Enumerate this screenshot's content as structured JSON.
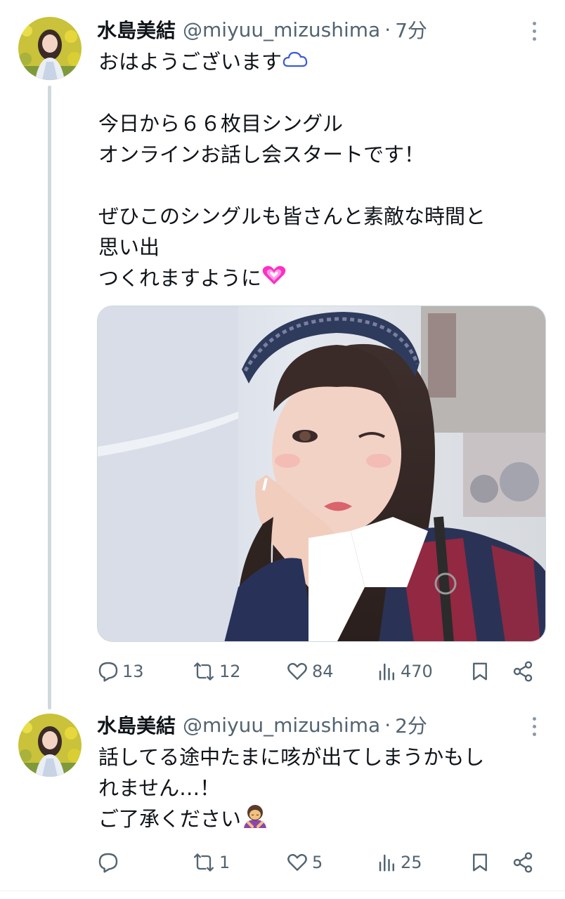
{
  "tweets": [
    {
      "display_name": "水島美結",
      "handle": "@miyuu_mizushima",
      "separator": "·",
      "timestamp": "7分",
      "text_lines": [
        "おはようございます",
        "",
        "今日から６６枚目シングル",
        "オンラインお話し会スタートです！",
        "",
        "ぜひこのシングルも皆さんと素敵な時間と",
        "思い出",
        "つくれますように"
      ],
      "emojis": [
        "cloud-icon",
        "heart-icon"
      ],
      "image_description_icon": "photo",
      "stats": {
        "replies": "13",
        "retweets": "12",
        "likes": "84",
        "views": "470"
      }
    },
    {
      "display_name": "水島美結",
      "handle": "@miyuu_mizushima",
      "separator": "·",
      "timestamp": "2分",
      "text_lines": [
        "話してる途中たまに咳が出てしまうかもし",
        "れません…！",
        "ご了承ください"
      ],
      "emojis": [
        "bowing-person-icon"
      ],
      "stats": {
        "replies": "",
        "retweets": "1",
        "likes": "5",
        "views": "25"
      }
    }
  ],
  "colors": {
    "text": "#0f1419",
    "muted": "#536471",
    "thread_line": "#cfd9de",
    "heart_emoji": "#ff2ec4",
    "cloud_emoji": "#3b5bdb"
  }
}
